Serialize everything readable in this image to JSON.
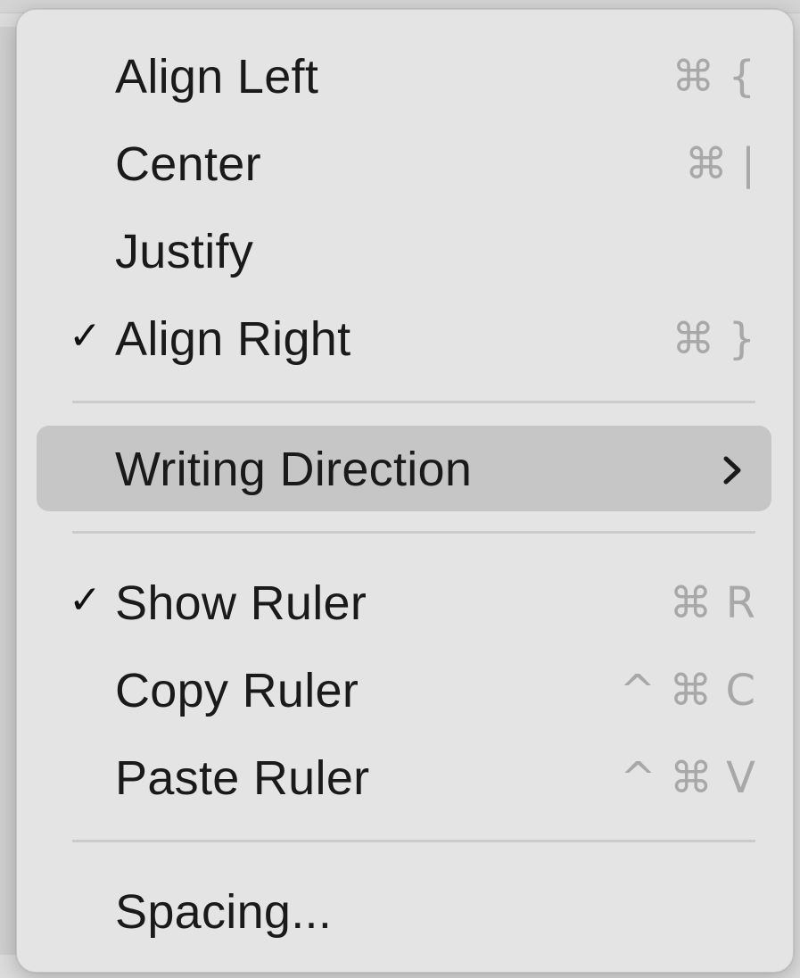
{
  "menu": {
    "items": [
      {
        "label": "Align Left",
        "shortcut": "⌘ {",
        "checked": false
      },
      {
        "label": "Center",
        "shortcut": "⌘ |",
        "checked": false
      },
      {
        "label": "Justify",
        "shortcut": "",
        "checked": false
      },
      {
        "label": "Align Right",
        "shortcut": "⌘ }",
        "checked": true
      },
      {
        "label": "Writing Direction",
        "submenu": true,
        "highlighted": true
      },
      {
        "label": "Show Ruler",
        "shortcut": "⌘ R",
        "checked": true
      },
      {
        "label": "Copy Ruler",
        "shortcut": "^ ⌘ C",
        "checked": false
      },
      {
        "label": "Paste Ruler",
        "shortcut": "^ ⌘ V",
        "checked": false
      },
      {
        "label": "Spacing...",
        "shortcut": "",
        "checked": false
      }
    ],
    "check_glyph": "✓",
    "chevron_icon": "chevron-right-icon",
    "colors": {
      "background": "#e4e4e4",
      "highlight": "#c6c6c6",
      "text": "#1a1a1a",
      "shortcut": "#a8a8a8"
    }
  }
}
